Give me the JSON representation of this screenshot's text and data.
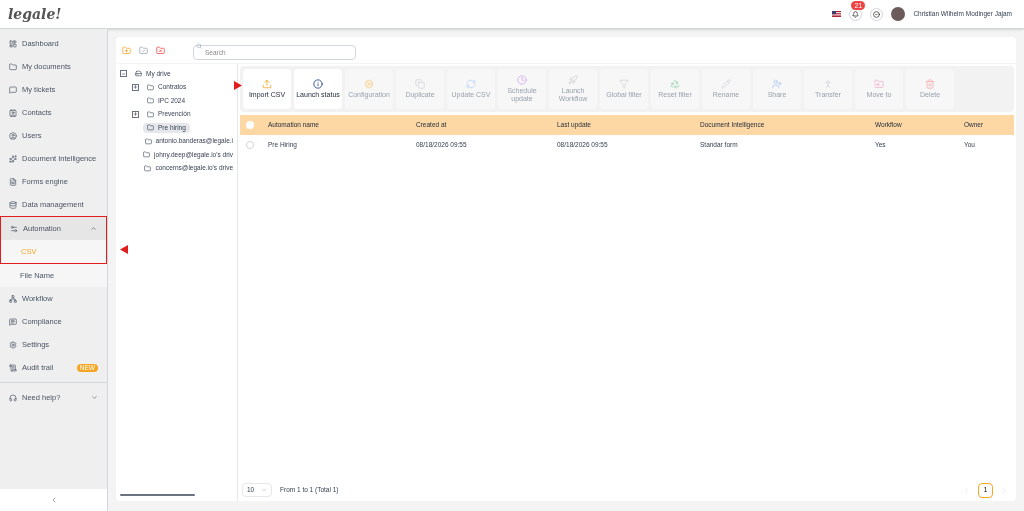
{
  "logo": {
    "text": "legale!"
  },
  "header": {
    "notifications": {
      "count": "21"
    },
    "user": {
      "name": "Christian Wilhelm Modinger Jajam"
    }
  },
  "sidebar": {
    "items": [
      {
        "label": "Dashboard",
        "selected": false
      },
      {
        "label": "My documents",
        "selected": false
      },
      {
        "label": "My tickets",
        "selected": false
      },
      {
        "label": "Contacts",
        "selected": false
      },
      {
        "label": "Users",
        "selected": false
      },
      {
        "label": "Document Intelligence",
        "selected": false
      },
      {
        "label": "Forms engine",
        "selected": false
      },
      {
        "label": "Data management",
        "selected": false
      },
      {
        "label": "Automation",
        "selected": false,
        "expanded": true,
        "highlighted": true,
        "children": [
          {
            "label": "CSV",
            "selected": true
          },
          {
            "label": "File Name",
            "selected": false
          }
        ]
      },
      {
        "label": "Workflow",
        "selected": false
      },
      {
        "label": "Compliance",
        "selected": false
      },
      {
        "label": "Settings",
        "selected": false
      },
      {
        "label": "Audit trail",
        "selected": false,
        "badge": "NEW"
      }
    ],
    "help": {
      "label": "Need help?",
      "expanded": false
    }
  },
  "search": {
    "placeholder": "Search"
  },
  "tree": [
    {
      "label": "My drive",
      "kind": "drive",
      "expanded": true,
      "selected": false,
      "children": [
        {
          "label": "Contratos",
          "kind": "folder",
          "expanded": false,
          "selected": false
        },
        {
          "label": "IPC 2024",
          "kind": "folder",
          "selected": false
        },
        {
          "label": "Prevención",
          "kind": "folder",
          "expanded": false,
          "selected": false
        },
        {
          "label": "Pre hiring",
          "kind": "folder",
          "selected": true
        }
      ]
    },
    {
      "label": "antonio.banderas@legale.i",
      "kind": "folder",
      "selected": false
    },
    {
      "label": "johny.deep@legale.io's driv",
      "kind": "folder",
      "selected": false
    },
    {
      "label": "concerns@legale.io's drive",
      "kind": "folder",
      "selected": false
    }
  ],
  "toolbar": [
    {
      "label": "Import CSV",
      "disabled": false
    },
    {
      "label": "Launch status",
      "disabled": false
    },
    {
      "label": "Configuration",
      "disabled": true
    },
    {
      "label": "Duplicate",
      "disabled": true
    },
    {
      "label": "Update CSV",
      "disabled": true
    },
    {
      "label": "Schedule update",
      "disabled": true
    },
    {
      "label": "Launch Workflow",
      "disabled": true
    },
    {
      "label": "Global filter",
      "disabled": true
    },
    {
      "label": "Reset filter",
      "disabled": true
    },
    {
      "label": "Rename",
      "disabled": true
    },
    {
      "label": "Share",
      "disabled": true
    },
    {
      "label": "Transfer",
      "disabled": true
    },
    {
      "label": "Move to",
      "disabled": true
    },
    {
      "label": "Delete",
      "disabled": true
    }
  ],
  "table": {
    "all_checked": false,
    "columns": [
      "Automation name",
      "Created at",
      "Last update",
      "Document Intelligence",
      "Workflow",
      "Owner"
    ],
    "rows": [
      {
        "checked": false,
        "cells": [
          "Pre Hiring",
          "08/18/2026 09:55",
          "08/18/2026 09:55",
          "Standar form",
          "Yes",
          "You"
        ]
      }
    ]
  },
  "pagination": {
    "page_size": "10",
    "summary": "From 1 to 1 (Total 1)",
    "pages": [
      {
        "label": "1",
        "selected": true
      }
    ]
  }
}
